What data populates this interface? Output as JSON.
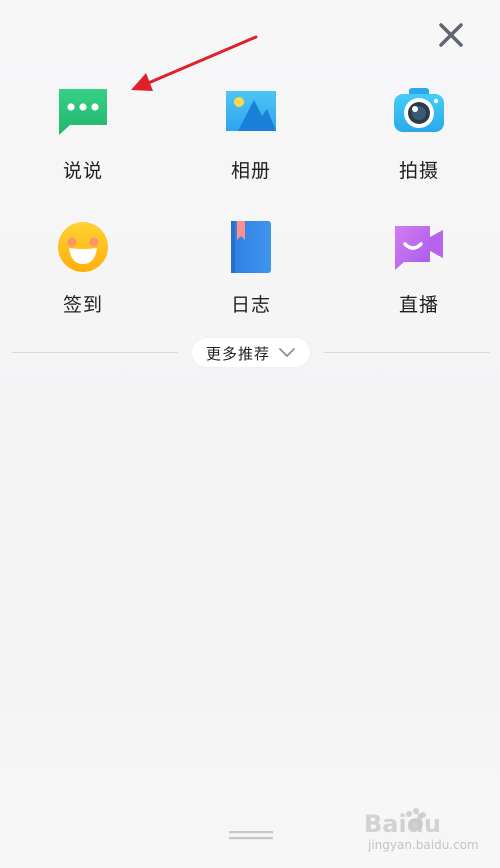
{
  "grid": {
    "items": [
      {
        "label": "说说",
        "icon": "speech-bubble-icon",
        "color": "#2fc27a"
      },
      {
        "label": "相册",
        "icon": "photo-album-icon",
        "color": "#3fb8f2"
      },
      {
        "label": "拍摄",
        "icon": "camera-icon",
        "color": "#38c0f0"
      },
      {
        "label": "签到",
        "icon": "smiley-face-icon",
        "color": "#ffc21a"
      },
      {
        "label": "日志",
        "icon": "journal-book-icon",
        "color": "#3b86e8"
      },
      {
        "label": "直播",
        "icon": "video-camera-icon",
        "color": "#c56cf0"
      }
    ]
  },
  "more": {
    "label": "更多推荐"
  },
  "annotation": {
    "arrow_color": "#e0202a"
  },
  "watermark": {
    "text": "Baidu",
    "subtext": "jingyan.baidu.com"
  }
}
